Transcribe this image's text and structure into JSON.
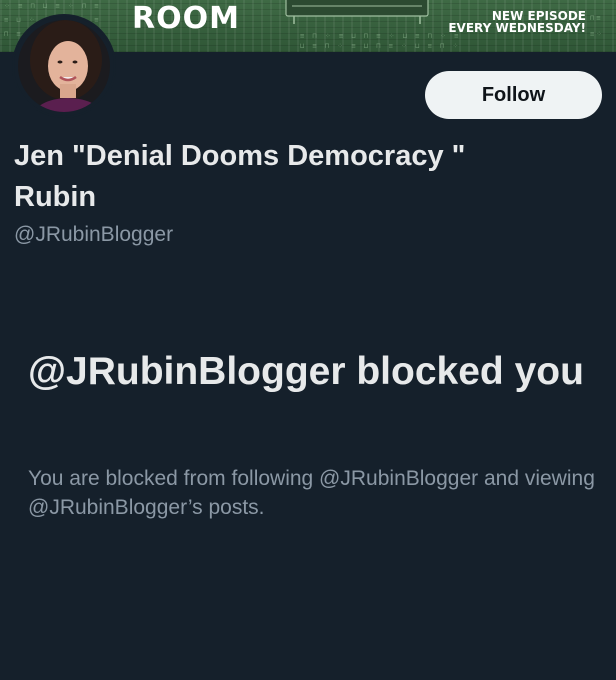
{
  "banner": {
    "title": "ROOM",
    "episode_line1": "NEW EPISODE",
    "episode_line2": "EVERY WEDNESDAY!",
    "accent_color": "#3f6a45"
  },
  "profile": {
    "display_name": "Jen \"Denial Dooms Democracy \" Rubin",
    "handle": "@JRubinBlogger",
    "follow_label": "Follow",
    "avatar_icon": "avatar-photo"
  },
  "blocked": {
    "title": "@JRubinBlogger blocked you",
    "description": "You are blocked from following @JRubinBlogger and viewing @JRubinBlogger’s posts."
  },
  "colors": {
    "background": "#15202b",
    "primary_text": "#e7e9ea",
    "secondary_text": "#8b98a5",
    "button_bg": "#eff3f4"
  }
}
